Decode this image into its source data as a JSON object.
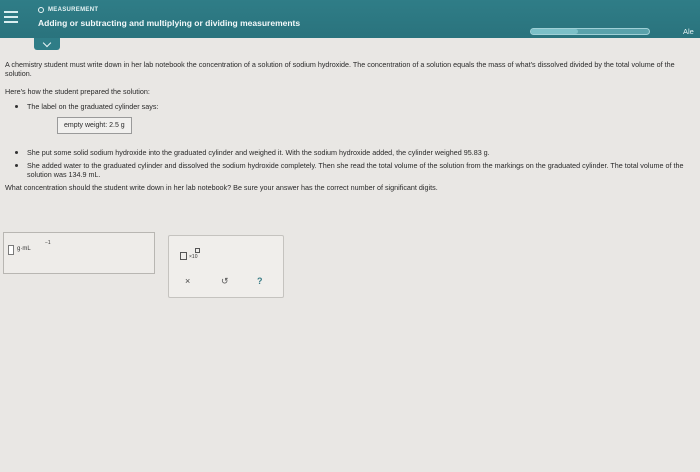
{
  "header": {
    "topic_label": "MEASUREMENT",
    "title": "Adding or subtracting and multiplying or dividing measurements",
    "user": "Ale",
    "progress_fraction": 0.4
  },
  "content": {
    "intro": "A chemistry student must write down in her lab notebook the concentration of a solution of sodium hydroxide. The concentration of a solution equals the mass of what's dissolved divided by the total volume of the solution.",
    "heading": "Here's how the student prepared the solution:",
    "bullet_1": "The label on the graduated cylinder says:",
    "label_box": "empty weight: 2.5 g",
    "bullet_2": "She put some solid sodium hydroxide into the graduated cylinder and weighed it. With the sodium hydroxide added, the cylinder weighed 95.83 g.",
    "bullet_3": "She added water to the graduated cylinder and dissolved the sodium hydroxide completely. Then she read the total volume of the solution from the markings on the graduated cylinder. The total volume of the solution was 134.9 mL.",
    "question": "What concentration should the student write down in her lab notebook? Be sure your answer has the correct number of significant digits."
  },
  "answer": {
    "unit": "g·mL",
    "exponent": "−1"
  },
  "tools": {
    "sci_notation_label": "×10",
    "clear": "×",
    "undo": "↺",
    "help": "?"
  }
}
